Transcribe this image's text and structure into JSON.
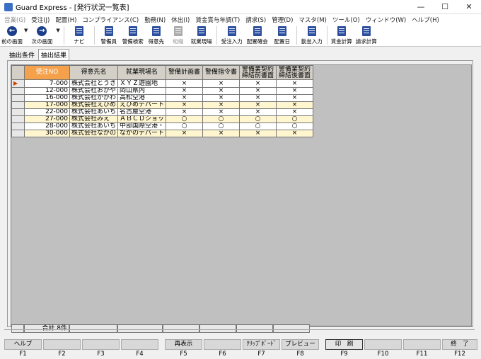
{
  "window": {
    "title": "Guard Express - [発行状況一覧表]",
    "minimize": "—",
    "maximize": "☐",
    "close": "✕"
  },
  "menu": [
    {
      "label": "営業(G)",
      "disabled": true
    },
    {
      "label": "受注(J)"
    },
    {
      "label": "配置(H)"
    },
    {
      "label": "コンプライアンス(C)"
    },
    {
      "label": "勤務(N)"
    },
    {
      "label": "休出(I)"
    },
    {
      "label": "賃金賞与年調(T)"
    },
    {
      "label": "請求(S)"
    },
    {
      "label": "管理(D)"
    },
    {
      "label": "マスタ(M)"
    },
    {
      "label": "ツール(O)"
    },
    {
      "label": "ウィンドウ(W)"
    },
    {
      "label": "ヘルプ(H)"
    }
  ],
  "toolbar": {
    "prev": "前の画面",
    "next": "次の画面",
    "navi": "ナビ",
    "guard": "警備員",
    "guard_search": "警備検索",
    "client": "得意先",
    "org": "組織",
    "site": "就業現場",
    "order_entry": "受注入力",
    "assign_confirm": "配置確会",
    "assign_day": "配置日",
    "attend_entry": "勤怠入力",
    "wage_calc": "賃金計算",
    "bill_calc": "請求計算"
  },
  "tabs": {
    "cond": "抽出条件",
    "result": "抽出結果"
  },
  "table": {
    "headers": {
      "order_no": "受注NO",
      "client": "得意先名",
      "site": "就業現場名",
      "plan": "警備計画書",
      "instr": "警備指令書",
      "pre": "警備業契約締結前書面",
      "post": "警備業契約締結後書面"
    },
    "rows": [
      {
        "no": "7-000",
        "client": "株式会社とうき",
        "site": "ＸＹＺ遊園地",
        "plan": "×",
        "instr": "×",
        "pre": "×",
        "post": "×"
      },
      {
        "no": "12-000",
        "client": "株式会社おかや",
        "site": "岡山県内",
        "plan": "×",
        "instr": "×",
        "pre": "×",
        "post": "×"
      },
      {
        "no": "16-000",
        "client": "株式会社かがわ",
        "site": "高松空港",
        "plan": "×",
        "instr": "×",
        "pre": "×",
        "post": "×"
      },
      {
        "no": "17-000",
        "client": "株式会社えひめ",
        "site": "えひめデパート",
        "plan": "×",
        "instr": "×",
        "pre": "×",
        "post": "×"
      },
      {
        "no": "22-000",
        "client": "株式会社あいち",
        "site": "名古屋空港",
        "plan": "×",
        "instr": "×",
        "pre": "×",
        "post": "×"
      },
      {
        "no": "27-000",
        "client": "株式会社みえ",
        "site": "ＡＢＣＤショッ",
        "plan": "○",
        "instr": "○",
        "pre": "○",
        "post": "○"
      },
      {
        "no": "28-000",
        "client": "株式会社あいち",
        "site": "中部国際空港・",
        "plan": "○",
        "instr": "○",
        "pre": "○",
        "post": "○"
      },
      {
        "no": "30-000",
        "client": "株式会社ながの",
        "site": "ながのデパート",
        "plan": "×",
        "instr": "×",
        "pre": "×",
        "post": "×"
      }
    ],
    "total_label": "合計",
    "total_count": "8件"
  },
  "fkeys": [
    {
      "label": "ヘルプ",
      "key": "F1"
    },
    {
      "label": "",
      "key": "F2"
    },
    {
      "label": "",
      "key": "F3"
    },
    {
      "label": "",
      "key": "F4"
    },
    {
      "label": "再表示",
      "key": "F5"
    },
    {
      "label": "",
      "key": "F6"
    },
    {
      "label": "ｸﾘｯﾌﾟﾎﾞｰﾄﾞ",
      "key": "F7"
    },
    {
      "label": "プレビュー",
      "key": "F8"
    },
    {
      "label": "印　刷",
      "key": "F9",
      "active": true
    },
    {
      "label": "",
      "key": "F10"
    },
    {
      "label": "",
      "key": "F11"
    },
    {
      "label": "終　了",
      "key": "F12"
    }
  ],
  "colors": {
    "header_highlight": "#f5a04a",
    "row_alt": "#fff6d0",
    "grid_bg": "#c0c0c0"
  }
}
